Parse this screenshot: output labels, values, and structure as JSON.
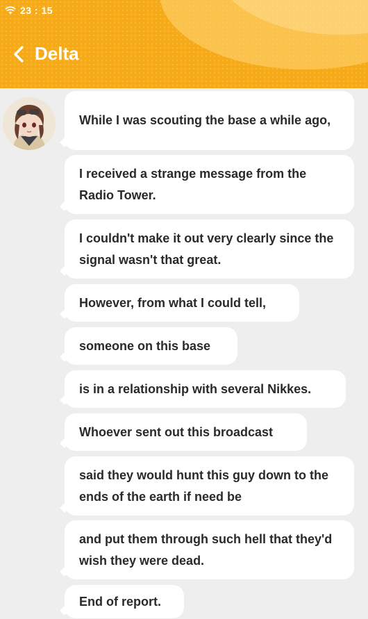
{
  "status_bar": {
    "time": "23 : 15"
  },
  "header": {
    "contact_name": "Delta"
  },
  "messages": [
    "While I was scouting the base a while ago,",
    "I received a strange message from the Radio Tower.",
    "I couldn't make it out very clearly since the signal wasn't that great.",
    "However, from what I could tell,",
    "someone on this base",
    "is in a relationship with several Nikkes.",
    "Whoever sent out this broadcast",
    "said they would hunt this guy down to the ends of the earth if need be",
    "and put them through such hell that they'd wish they were dead.",
    "End of report."
  ],
  "colors": {
    "header": "#f6aa17",
    "background": "#eeeeee",
    "bubble": "#ffffff",
    "text": "#2a2a2a"
  },
  "icons": {
    "status": "wifi-icon",
    "nav": "back-chevron-icon"
  }
}
